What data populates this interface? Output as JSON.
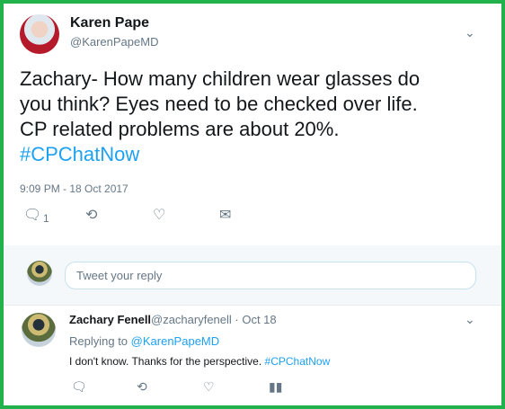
{
  "tweet": {
    "author_name": "Karen Pape",
    "author_handle": "@KarenPapeMD",
    "text_lines": [
      "Zachary- How many children wear glasses do",
      "you think? Eyes need to be checked over life.",
      "CP related problems are about 20%."
    ],
    "hashtag": "#CPChatNow",
    "timestamp": "9:09 PM - 18 Oct 2017",
    "reply_count": "1",
    "icons": [
      "reply-icon",
      "retweet-icon",
      "like-icon",
      "message-icon",
      "chevron-down-icon"
    ]
  },
  "reply_box": {
    "placeholder": "Tweet your reply"
  },
  "reply": {
    "author_name": "Zachary Fenell",
    "author_meta": "@zacharyfenell · Oct 18",
    "replying_prefix": "Replying to",
    "replying_to": "@KarenPapeMD",
    "text": "I don't know. Thanks for the perspective.",
    "hashtag": "#CPChatNow",
    "icons": [
      "reply-icon",
      "retweet-icon",
      "like-icon",
      "analytics-icon",
      "chevron-down-icon"
    ]
  },
  "colors": {
    "border": "#22b24c",
    "link": "#1da1f2",
    "secondary_text": "#657786"
  }
}
